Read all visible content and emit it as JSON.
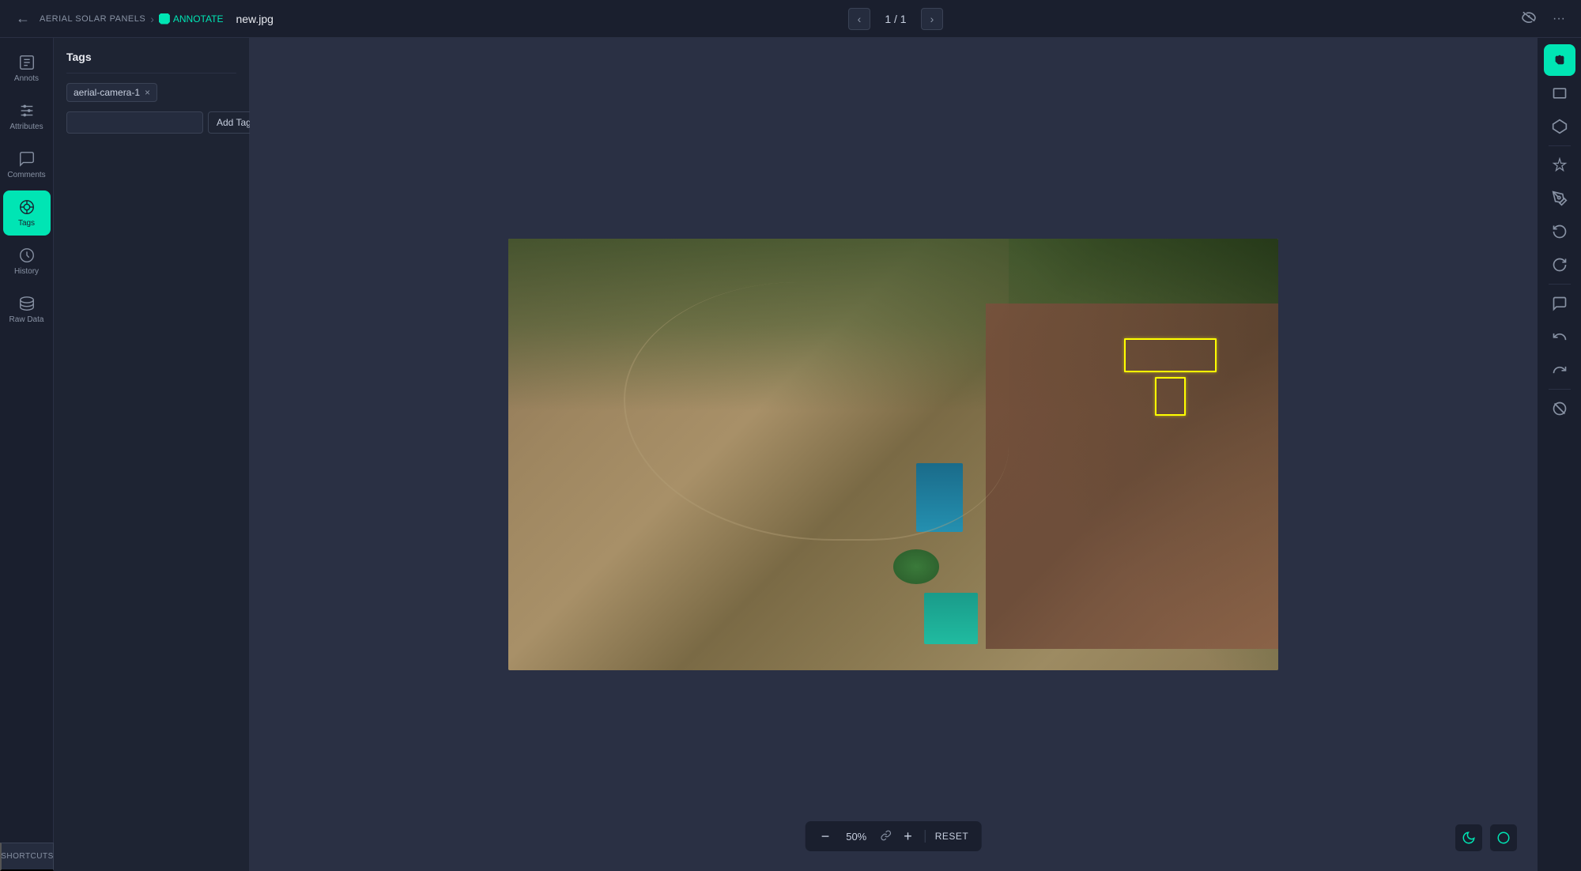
{
  "topbar": {
    "back_arrow": "‹",
    "project_name": "AERIAL SOLAR PANELS",
    "breadcrumb_sep": "›",
    "annotate_label": "ANNOTATE",
    "filename": "new.jpg",
    "page_current": "1",
    "page_total": "1",
    "page_display": "1 / 1"
  },
  "sidebar": {
    "items": [
      {
        "id": "annots",
        "label": "Annots",
        "active": false
      },
      {
        "id": "attributes",
        "label": "Attributes",
        "active": false
      },
      {
        "id": "comments",
        "label": "Comments",
        "active": false
      },
      {
        "id": "tags",
        "label": "Tags",
        "active": true
      },
      {
        "id": "history",
        "label": "History",
        "active": false
      },
      {
        "id": "rawdata",
        "label": "Raw Data",
        "active": false
      }
    ]
  },
  "panel": {
    "title": "Tags",
    "tag": "aerial-camera-1",
    "tag_close": "×",
    "input_placeholder": "",
    "add_tag_label": "Add Tag"
  },
  "zoom": {
    "minus": "−",
    "value": "50%",
    "plus": "+",
    "reset_label": "RESET"
  },
  "right_toolbar": {
    "tools": [
      {
        "id": "hand",
        "label": "Hand tool",
        "active": true,
        "icon": "✋"
      },
      {
        "id": "rect",
        "label": "Rectangle",
        "active": false,
        "icon": "▭"
      },
      {
        "id": "polygon",
        "label": "Polygon",
        "active": false,
        "icon": "⬡"
      },
      {
        "id": "separator1"
      },
      {
        "id": "ai",
        "label": "AI tool",
        "active": false,
        "icon": "✦"
      },
      {
        "id": "brush",
        "label": "Brush",
        "active": false,
        "icon": "✏"
      },
      {
        "id": "rotate-left",
        "label": "Rotate left",
        "active": false,
        "icon": "↺"
      },
      {
        "id": "rotate-right",
        "label": "Rotate right",
        "active": false,
        "icon": "↻"
      },
      {
        "id": "separator2"
      },
      {
        "id": "comment",
        "label": "Comment",
        "active": false,
        "icon": "💬"
      },
      {
        "id": "undo",
        "label": "Undo",
        "active": false,
        "icon": "↩"
      },
      {
        "id": "redo",
        "label": "Redo",
        "active": false,
        "icon": "↪"
      },
      {
        "id": "separator3"
      },
      {
        "id": "clear",
        "label": "Clear",
        "active": false,
        "icon": "⊘"
      }
    ]
  },
  "shortcuts": {
    "label": "SHORTCUTS"
  }
}
